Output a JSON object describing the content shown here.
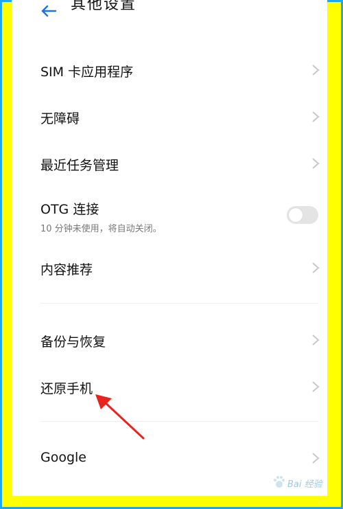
{
  "header": {
    "title": "其他设置",
    "back_icon": "back-arrow-icon"
  },
  "items": [
    {
      "label": "SIM 卡应用程序"
    },
    {
      "label": "无障碍"
    },
    {
      "label": "最近任务管理"
    },
    {
      "label": "OTG 连接",
      "subtitle": "10 分钟未使用，将自动关闭。",
      "toggle_on": false
    },
    {
      "label": "内容推荐"
    },
    {
      "label": "备份与恢复"
    },
    {
      "label": "还原手机"
    },
    {
      "label": "Google"
    }
  ],
  "annotation": {
    "arrow_color": "#e8231b"
  },
  "watermark": {
    "text": "Bai 经验"
  },
  "colors": {
    "frame_outer": "#1ea7f0",
    "frame_inner": "#ffff00",
    "accent": "#1a73e8"
  }
}
